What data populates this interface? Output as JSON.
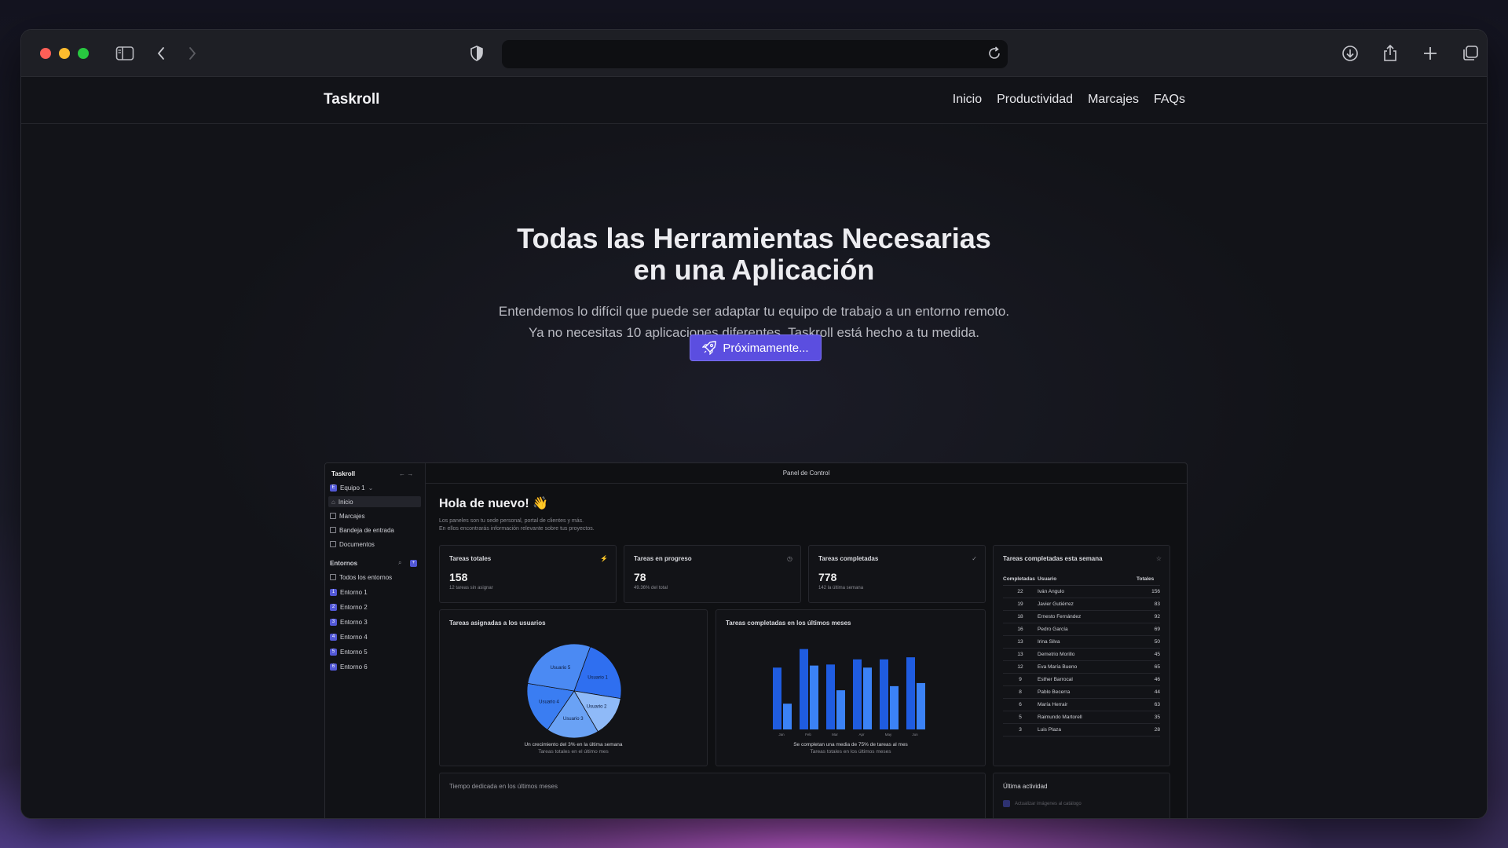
{
  "browser": {
    "url": ""
  },
  "site": {
    "brand": "Taskroll",
    "nav": [
      "Inicio",
      "Productividad",
      "Marcajes",
      "FAQs"
    ]
  },
  "hero": {
    "title_line1": "Todas las Herramientas Necesarias",
    "title_line2": "en una Aplicación",
    "sub_line1": "Entendemos lo difícil que puede ser adaptar tu equipo de trabajo a un entorno remoto.",
    "sub_line2": "Ya no necesitas 10 aplicaciones diferentes. Taskroll está hecho a tu medida.",
    "cta": "Próximamente...",
    "cta_color": "#5b4ee0"
  },
  "dashboard": {
    "app_name": "Taskroll",
    "team": "Equipo 1",
    "team_initial": "E",
    "nav": [
      "Inicio",
      "Marcajes",
      "Bandeja de entrada",
      "Documentos"
    ],
    "envs_heading": "Entornos",
    "all_envs": "Todos los entornos",
    "envs": [
      {
        "n": "1",
        "label": "Entorno 1"
      },
      {
        "n": "2",
        "label": "Entorno 2"
      },
      {
        "n": "3",
        "label": "Entorno 3"
      },
      {
        "n": "4",
        "label": "Entorno 4"
      },
      {
        "n": "5",
        "label": "Entorno 5"
      },
      {
        "n": "6",
        "label": "Entorno 6"
      }
    ],
    "header": "Panel de Control",
    "greeting": "Hola de nuevo! 👋",
    "intro1": "Los paneles son tu sede personal, portal de clientes y más.",
    "intro2": "En ellos encontrarás información relevante sobre tus proyectos.",
    "stats": [
      {
        "title": "Tareas totales",
        "value": "158",
        "sub": "12 tareas sin asignar",
        "icon": "⚡"
      },
      {
        "title": "Tareas en progreso",
        "value": "78",
        "sub": "49.36% del total",
        "icon": "◷"
      },
      {
        "title": "Tareas completadas",
        "value": "778",
        "sub": "142 la última semana",
        "icon": "✓"
      }
    ],
    "week": {
      "title": "Tareas completadas esta semana",
      "headers": [
        "Completadas",
        "Usuario",
        "Totales"
      ],
      "rows": [
        [
          "22",
          "Iván Angulo",
          "156"
        ],
        [
          "19",
          "Javier Gutiérrez",
          "83"
        ],
        [
          "18",
          "Ernesto Fernández",
          "92"
        ],
        [
          "16",
          "Pedro García",
          "69"
        ],
        [
          "13",
          "Irina Silva",
          "50"
        ],
        [
          "13",
          "Demetrio Morillo",
          "45"
        ],
        [
          "12",
          "Eva María Bueno",
          "65"
        ],
        [
          "9",
          "Esther Barrocal",
          "46"
        ],
        [
          "8",
          "Pablo Becerra",
          "44"
        ],
        [
          "6",
          "María Herrair",
          "63"
        ],
        [
          "5",
          "Raimundo Martorell",
          "35"
        ],
        [
          "3",
          "Luis Plaza",
          "28"
        ]
      ]
    },
    "pie_title": "Tareas asignadas a los usuarios",
    "pie_cap1": "Un crecimiento del 3% en la última semana",
    "pie_cap2": "Tareas totales en el último mes",
    "bar_title": "Tareas completadas en los últimos meses",
    "bar_cap1": "Se completan una media de 75% de tareas al mes",
    "bar_cap2": "Tareas totales en los últimos meses",
    "time_title": "Tiempo dedicada en los últimos meses",
    "activity_title": "Última actividad",
    "activity_item": "Actualizar imágenes al catálogo"
  },
  "chart_data": [
    {
      "type": "pie",
      "title": "Tareas asignadas a los usuarios",
      "categories": [
        "Usuario 1",
        "Usuario 2",
        "Usuario 3",
        "Usuario 4",
        "Usuario 5"
      ],
      "values": [
        22,
        14,
        18,
        18,
        28
      ],
      "colors": [
        "#2f6ff0",
        "#8fbaf8",
        "#6aa2f5",
        "#3a7df2",
        "#4b8af3"
      ]
    },
    {
      "type": "bar",
      "title": "Tareas completadas en los últimos meses",
      "categories": [
        "Jan",
        "Feb",
        "Mar",
        "Apr",
        "May",
        "Jun"
      ],
      "series": [
        {
          "values": [
            60,
            78,
            63,
            68,
            68,
            70
          ],
          "color": "#1f5ce0"
        },
        {
          "values": [
            25,
            62,
            38,
            60,
            42,
            45
          ],
          "color": "#3b82f6"
        }
      ],
      "ylim": [
        0,
        80
      ]
    }
  ]
}
